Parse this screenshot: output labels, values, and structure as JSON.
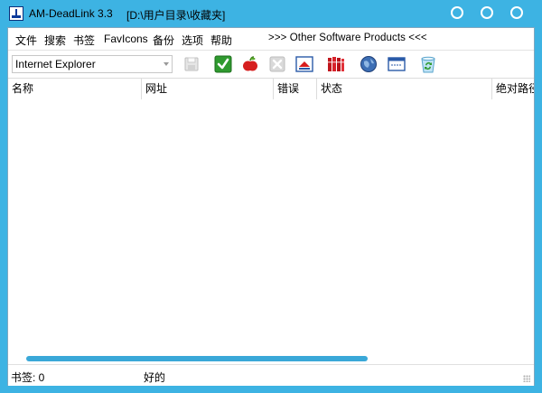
{
  "window": {
    "title": "AM-DeadLink 3.3",
    "path": "[D:\\用户目录\\收藏夹]"
  },
  "menu": {
    "items": [
      "文件",
      "搜索",
      "书签",
      "FavIcons",
      "备份",
      "选项",
      "帮助"
    ],
    "other_products": ">>> Other Software Products <<<"
  },
  "toolbar": {
    "browser_selected": "Internet Explorer",
    "icons": [
      "save-icon",
      "check-icon",
      "apple-icon",
      "delete-icon",
      "upload-icon",
      "bookmarks-icon",
      "globe-icon",
      "window-icon",
      "recycle-icon"
    ]
  },
  "list": {
    "columns": [
      "名称",
      "网址",
      "错误",
      "状态",
      "绝对路径"
    ]
  },
  "status": {
    "bookmarks": "书签: 0",
    "state": "好的"
  },
  "colors": {
    "frame": "#3db3e3",
    "scrollbar": "#3aa8d8"
  }
}
